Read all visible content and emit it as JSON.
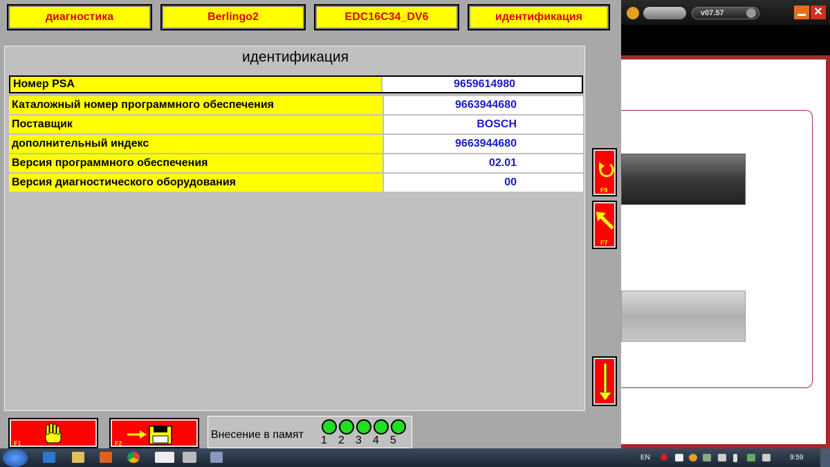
{
  "header": {
    "tabs": [
      "диагностика",
      "Berlingo2",
      "EDC16C34_DV6",
      "идентификация"
    ]
  },
  "panel": {
    "title": "идентификация",
    "rows": [
      {
        "label": "Номер PSA",
        "value": "9659614980"
      },
      {
        "label": "Каталожный номер программного обеспечения",
        "value": "9663944680"
      },
      {
        "label": "Поставщик",
        "value": "BOSCH"
      },
      {
        "label": "дополнительный индекс",
        "value": "9663944680"
      },
      {
        "label": "Версия программного обеспечения",
        "value": "02.01"
      },
      {
        "label": "Версия диагностического оборудования",
        "value": "00"
      }
    ]
  },
  "side_buttons": {
    "f9_label": "F9",
    "f7_label": "F7"
  },
  "bottom": {
    "f1_label": "F1",
    "f2_label": "F2",
    "memory_label": "Внесение в памят",
    "slots": [
      "1",
      "2",
      "3",
      "4",
      "5"
    ]
  },
  "right_app": {
    "version": "v07.57"
  },
  "taskbar": {
    "lang": "EN",
    "clock": "9:59"
  },
  "colors": {
    "header_bg": "#ffff00",
    "header_text": "#e00000",
    "value_text": "#1a1acc",
    "button_red": "#ff0000",
    "led_green": "#22dd22",
    "right_brand": "#a52a2a"
  }
}
